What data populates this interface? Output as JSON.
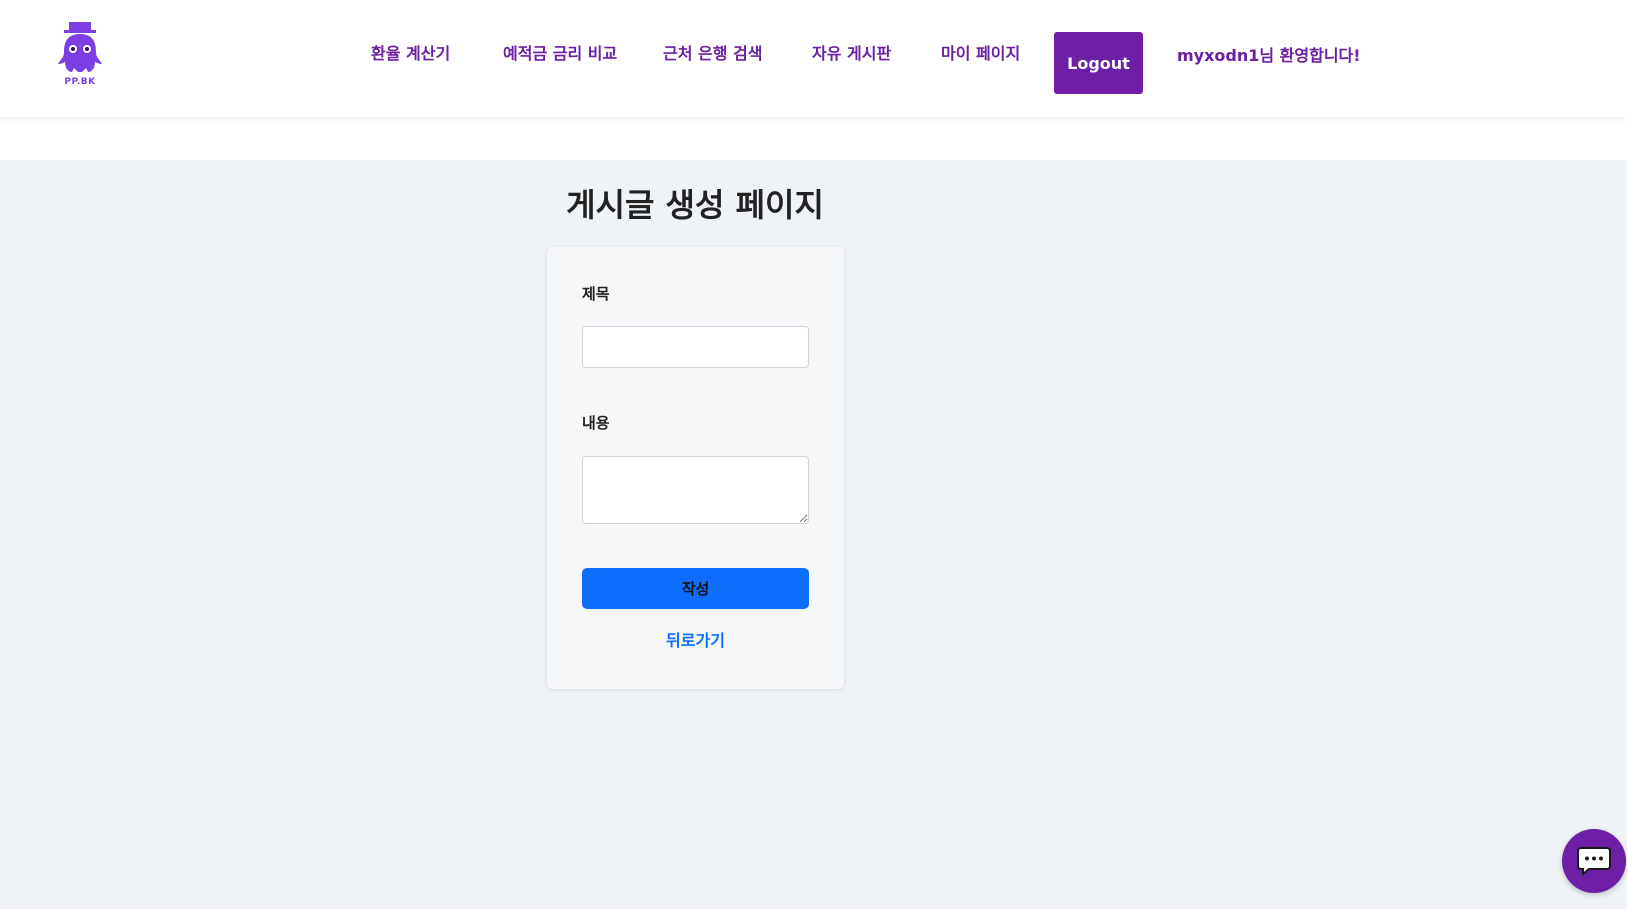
{
  "brand": {
    "logo_text": "PP.BK",
    "logo_color": "#7b3fe4"
  },
  "nav": {
    "links": [
      {
        "label": "환율 계산기"
      },
      {
        "label": "예적금 금리 비교"
      },
      {
        "label": "근처 은행 검색"
      },
      {
        "label": "자유 게시판"
      },
      {
        "label": "마이 페이지"
      }
    ],
    "logout_label": "Logout",
    "welcome_text": "myxodn1님 환영합니다!",
    "accent_color": "#6f1fa6"
  },
  "page": {
    "title": "게시글 생성 페이지"
  },
  "form": {
    "title_label": "제목",
    "title_value": "",
    "content_label": "내용",
    "content_value": "",
    "submit_label": "작성",
    "submit_color": "#0d6efd",
    "back_label": "뒤로가기"
  },
  "chat": {
    "icon": "chat-bubble-icon"
  }
}
